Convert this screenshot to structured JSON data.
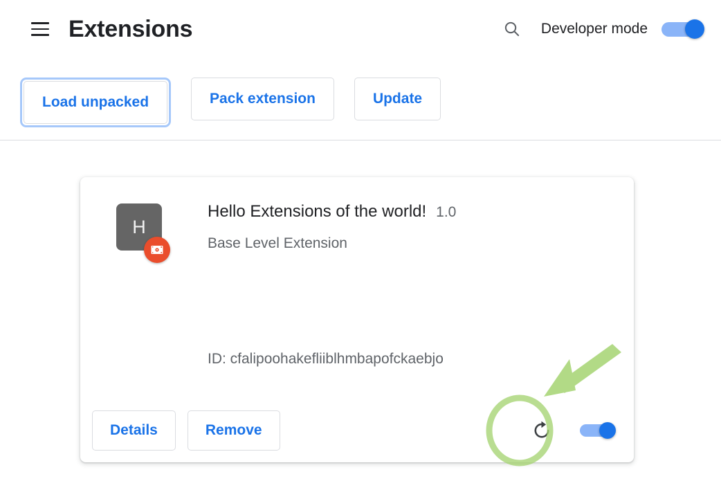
{
  "header": {
    "menu_icon": "hamburger-menu-icon",
    "title": "Extensions",
    "search_icon": "search-icon",
    "developer_mode_label": "Developer mode",
    "developer_mode_on": true
  },
  "toolbar": {
    "load_unpacked_label": "Load unpacked",
    "pack_extension_label": "Pack extension",
    "update_label": "Update",
    "focused_button": "Load unpacked"
  },
  "extension": {
    "icon_letter": "H",
    "badge_icon": "unpacked-extension-icon",
    "name": "Hello Extensions of the world!",
    "version": "1.0",
    "description": "Base Level Extension",
    "id_text": "ID: cfalipoohakefliiblhmbapofckaebjo",
    "details_label": "Details",
    "remove_label": "Remove",
    "reload_icon": "reload-icon",
    "enabled": true
  },
  "annotations": {
    "arrow_icon": "green-arrow-pointing-to-reload",
    "highlight_icon": "green-circle-highlight-on-reload"
  },
  "colors": {
    "accent_blue": "#1a73e8",
    "toggle_track": "#8ab4f8",
    "text_primary": "#202124",
    "text_secondary": "#5f6368",
    "border": "#dadce0",
    "icon_gray": "#656565",
    "badge_orange": "#ea4d2c",
    "annotation_green": "#a5d princ"
  }
}
